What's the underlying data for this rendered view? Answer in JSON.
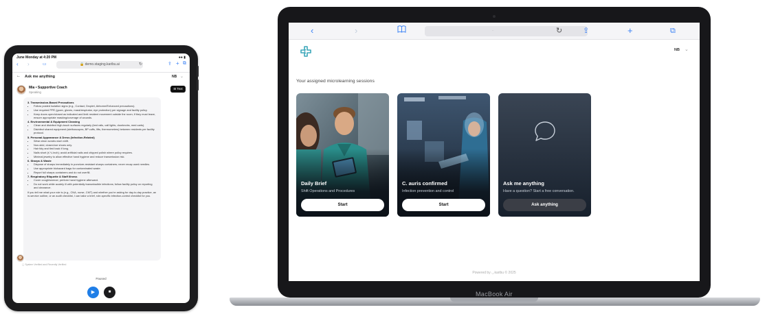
{
  "ipad": {
    "status_time": "June Monday at 4:20 PM",
    "status_right": "●● ▮",
    "tab_label": "AA",
    "url": "🔒 demo.staging.karibu.ai",
    "back_label": "←",
    "header_title": "Ask me anything",
    "language": "NB",
    "coach_name": "Mia • Supportive Coach",
    "coach_status": "Speaking",
    "text_button": "⊟ Text",
    "sections": [
      {
        "heading": "3. Transmission-Based Precautions",
        "items": [
          "Follow posted isolation signs (e.g., Contact, Droplet, Airborne/Enhanced precautions).",
          "Use required PPE (gown, gloves, mask/respirator, eye protection) per signage and facility policy.",
          "Keep doors open/closed as indicated and limit resident movement outside the room; if they must leave, ensure appropriate masking/coverage of wounds."
        ]
      },
      {
        "heading": "4. Environmental & Equipment Cleaning",
        "items": [
          "Clean and disinfect high-touch surfaces regularly (bed rails, call lights, doorknobs, med carts).",
          "Disinfect shared equipment (stethoscopes, BP cuffs, lifts, thermometers) between residents per facility protocol."
        ]
      },
      {
        "heading": "5. Personal Appearance & Dress (Infection-Related)",
        "items": [
          "Wear clean scrubs each shift.",
          "Non-skid, closed-toe shoes only.",
          "Hair tidy and tied back if long.",
          "Nails short (≤ ¼ inch); avoid artificial nails and chipped polish where policy requires.",
          "Minimal jewelry to allow effective hand hygiene and reduce transmission risk."
        ]
      },
      {
        "heading": "6. Sharps & Waste",
        "items": [
          "Dispose of sharps immediately in puncture-resistant sharps containers; never recap used needles.",
          "Use appropriate biohazard bags for contaminated waste.",
          "Report full sharps containers and do not overfill."
        ]
      },
      {
        "heading": "7. Respiratory Etiquette & Staff Illness",
        "items": [
          "Cover cough/sneeze; perform hand hygiene afterward.",
          "Do not work while acutely ill with potentially transmissible infections; follow facility policy on reporting and clearance."
        ]
      }
    ],
    "closing_text": "If you tell me what your role is (e.g., CNA, nurse, CMT) and whether you're asking for day-to-day practice, an in-service outline, or an audit checklist, I can tailor a brief, role-specific infection-control checklist for you.",
    "sources": "▢ System Verified and Recently Verified",
    "paused_label": "Paused",
    "play_icon": "▶",
    "stop_icon": "■"
  },
  "mac": {
    "toolbar": {
      "back": "‹",
      "forward": "›",
      "bookmarks": "📖",
      "address_dots": "·",
      "reload": "↻",
      "share": "⇪",
      "new_tab": "+",
      "tabs": "⧉"
    },
    "language": "NB",
    "language_chevron": "⌄",
    "sessions_title": "Your assigned microlearning sessions",
    "cards": [
      {
        "title": "Daily Brief",
        "subtitle": "Shift Operations and Procedures",
        "button": "Start"
      },
      {
        "title": "C. auris confirmed",
        "subtitle": "Infection prevention and control",
        "button": "Start"
      },
      {
        "title": "Ask me anything",
        "subtitle": "Have a question? Start a free conversation.",
        "button": "Ask anything"
      }
    ],
    "footer": "Powered by ◡karibu   © 2025",
    "device_label": "MacBook Air"
  },
  "colors": {
    "accent_blue": "#1f7ee7",
    "logo_teal": "#3aa6b9",
    "card_dark": "#1f2735"
  }
}
